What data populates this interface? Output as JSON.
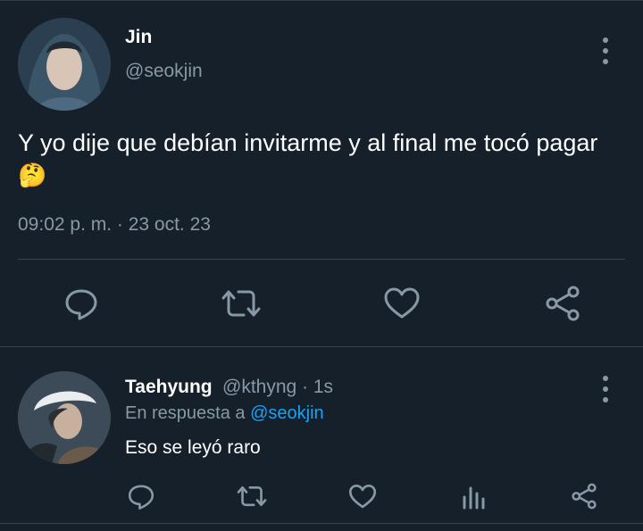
{
  "main_tweet": {
    "author_name": "Jin",
    "author_handle": "@seokjin",
    "text": "Y yo dije que debían invitarme y al final me tocó pagar",
    "emoji": "🤔",
    "timestamp": "09:02 p. m. · 23 oct. 23",
    "actions": [
      "reply-icon",
      "retweet-icon",
      "like-icon",
      "share-icon"
    ]
  },
  "reply": {
    "author_name": "Taehyung",
    "author_handle": "@kthyng",
    "time": "· 1s",
    "in_reply_prefix": "En respuesta a",
    "in_reply_mention": "@seokjin",
    "text": "Eso se leyó raro",
    "actions": [
      "reply-icon",
      "retweet-icon",
      "like-icon",
      "analytics-icon",
      "share-icon"
    ]
  },
  "colors": {
    "background": "#15202b",
    "muted": "#8899a6",
    "accent": "#1da1f2"
  }
}
